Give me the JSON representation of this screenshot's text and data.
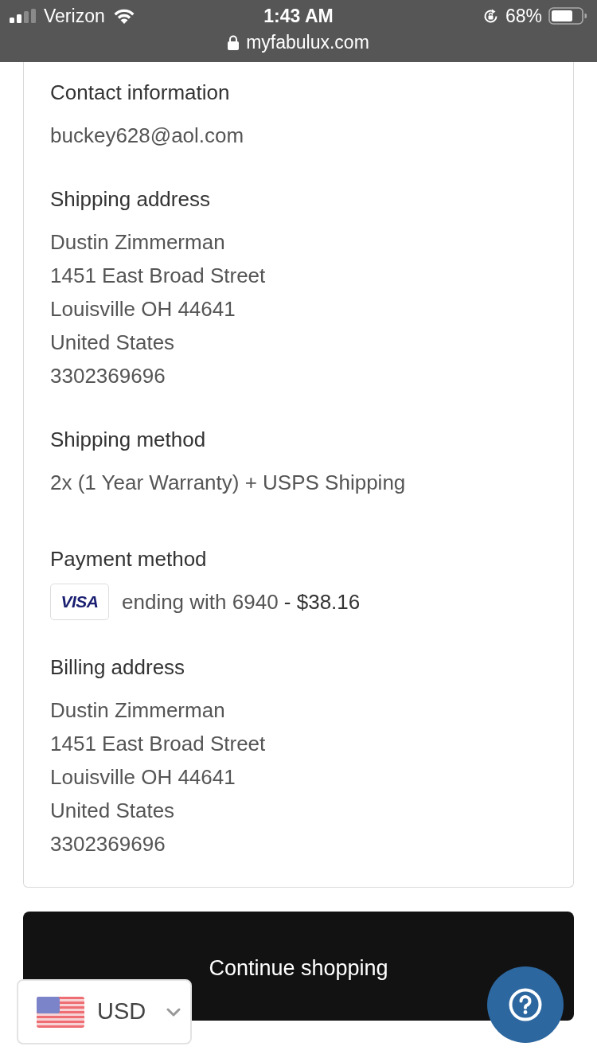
{
  "status_bar": {
    "carrier": "Verizon",
    "time": "1:43 AM",
    "battery_percent": "68%",
    "url": "myfabulux.com"
  },
  "sections": [
    {
      "kind": "text",
      "title": "Contact information",
      "lines": [
        "buckey628@aol.com"
      ]
    },
    {
      "kind": "text",
      "title": "Shipping address",
      "lines": [
        "Dustin Zimmerman",
        "1451 East Broad Street",
        "Louisville OH 44641",
        "United States",
        "3302369696"
      ]
    },
    {
      "kind": "text",
      "title": "Shipping method",
      "lines": [
        "2x (1 Year Warranty) + USPS Shipping"
      ]
    },
    {
      "kind": "payment",
      "title": "Payment method",
      "card_brand": "VISA",
      "detail": "ending with 6940 **- $38.16**"
    },
    {
      "kind": "text",
      "title": "Billing address",
      "lines": [
        "Dustin Zimmerman",
        "1451 East Broad Street",
        "Louisville OH 44641",
        "United States",
        "3302369696"
      ]
    }
  ],
  "continue_button": {
    "label": "Continue shopping"
  },
  "currency_selector": {
    "currency": "USD"
  }
}
